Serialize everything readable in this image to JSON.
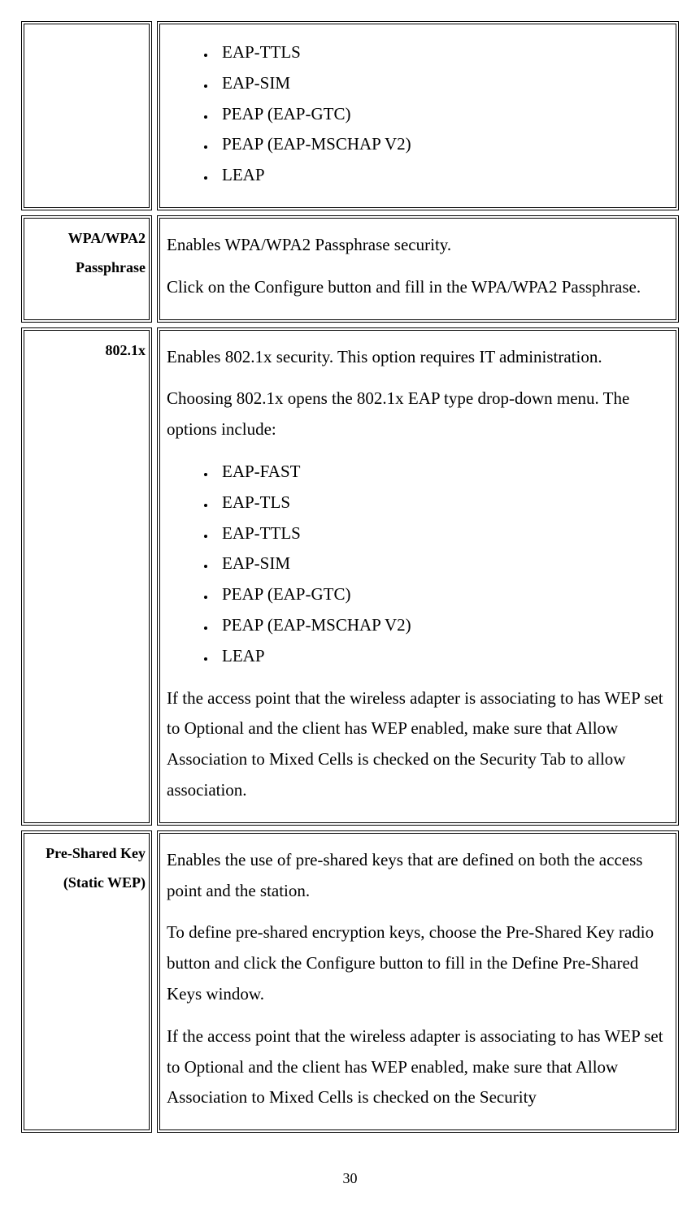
{
  "rows": [
    {
      "label": "",
      "content_blocks": [
        {
          "type": "list",
          "items": [
            "EAP-TTLS",
            "EAP-SIM",
            "PEAP (EAP-GTC)",
            "PEAP (EAP-MSCHAP V2)",
            "LEAP"
          ]
        }
      ]
    },
    {
      "label": "WPA/WPA2 Passphrase",
      "content_blocks": [
        {
          "type": "para",
          "text": "Enables WPA/WPA2 Passphrase security."
        },
        {
          "type": "para",
          "text": "Click on the Configure button and fill in the WPA/WPA2 Passphrase."
        }
      ]
    },
    {
      "label": "802.1x",
      "content_blocks": [
        {
          "type": "para",
          "text": "Enables 802.1x security.   This option requires IT administration."
        },
        {
          "type": "para",
          "text": "Choosing 802.1x opens the 802.1x EAP type drop-down menu.   The options include:"
        },
        {
          "type": "list",
          "items": [
            "EAP-FAST",
            "EAP-TLS",
            "EAP-TTLS",
            "EAP-SIM",
            "PEAP (EAP-GTC)",
            "PEAP (EAP-MSCHAP V2)",
            "LEAP"
          ]
        },
        {
          "type": "para",
          "text": "If the access point that the wireless adapter is associating to has WEP set to Optional and the client has WEP enabled, make sure that Allow Association to Mixed Cells is checked on the Security Tab to allow association."
        }
      ]
    },
    {
      "label": "Pre-Shared Key (Static WEP)",
      "content_blocks": [
        {
          "type": "para",
          "text": "Enables the use of pre-shared keys that are defined on both the access point and the station."
        },
        {
          "type": "para",
          "text": "To define pre-shared encryption keys, choose the Pre-Shared Key radio button and click the Configure button to fill in the Define Pre-Shared Keys window."
        },
        {
          "type": "para",
          "text": "If the access point that the wireless adapter is associating to has WEP set to Optional and the client has WEP enabled, make sure that Allow Association to Mixed Cells is checked on the Security"
        }
      ]
    }
  ],
  "page_number": "30"
}
